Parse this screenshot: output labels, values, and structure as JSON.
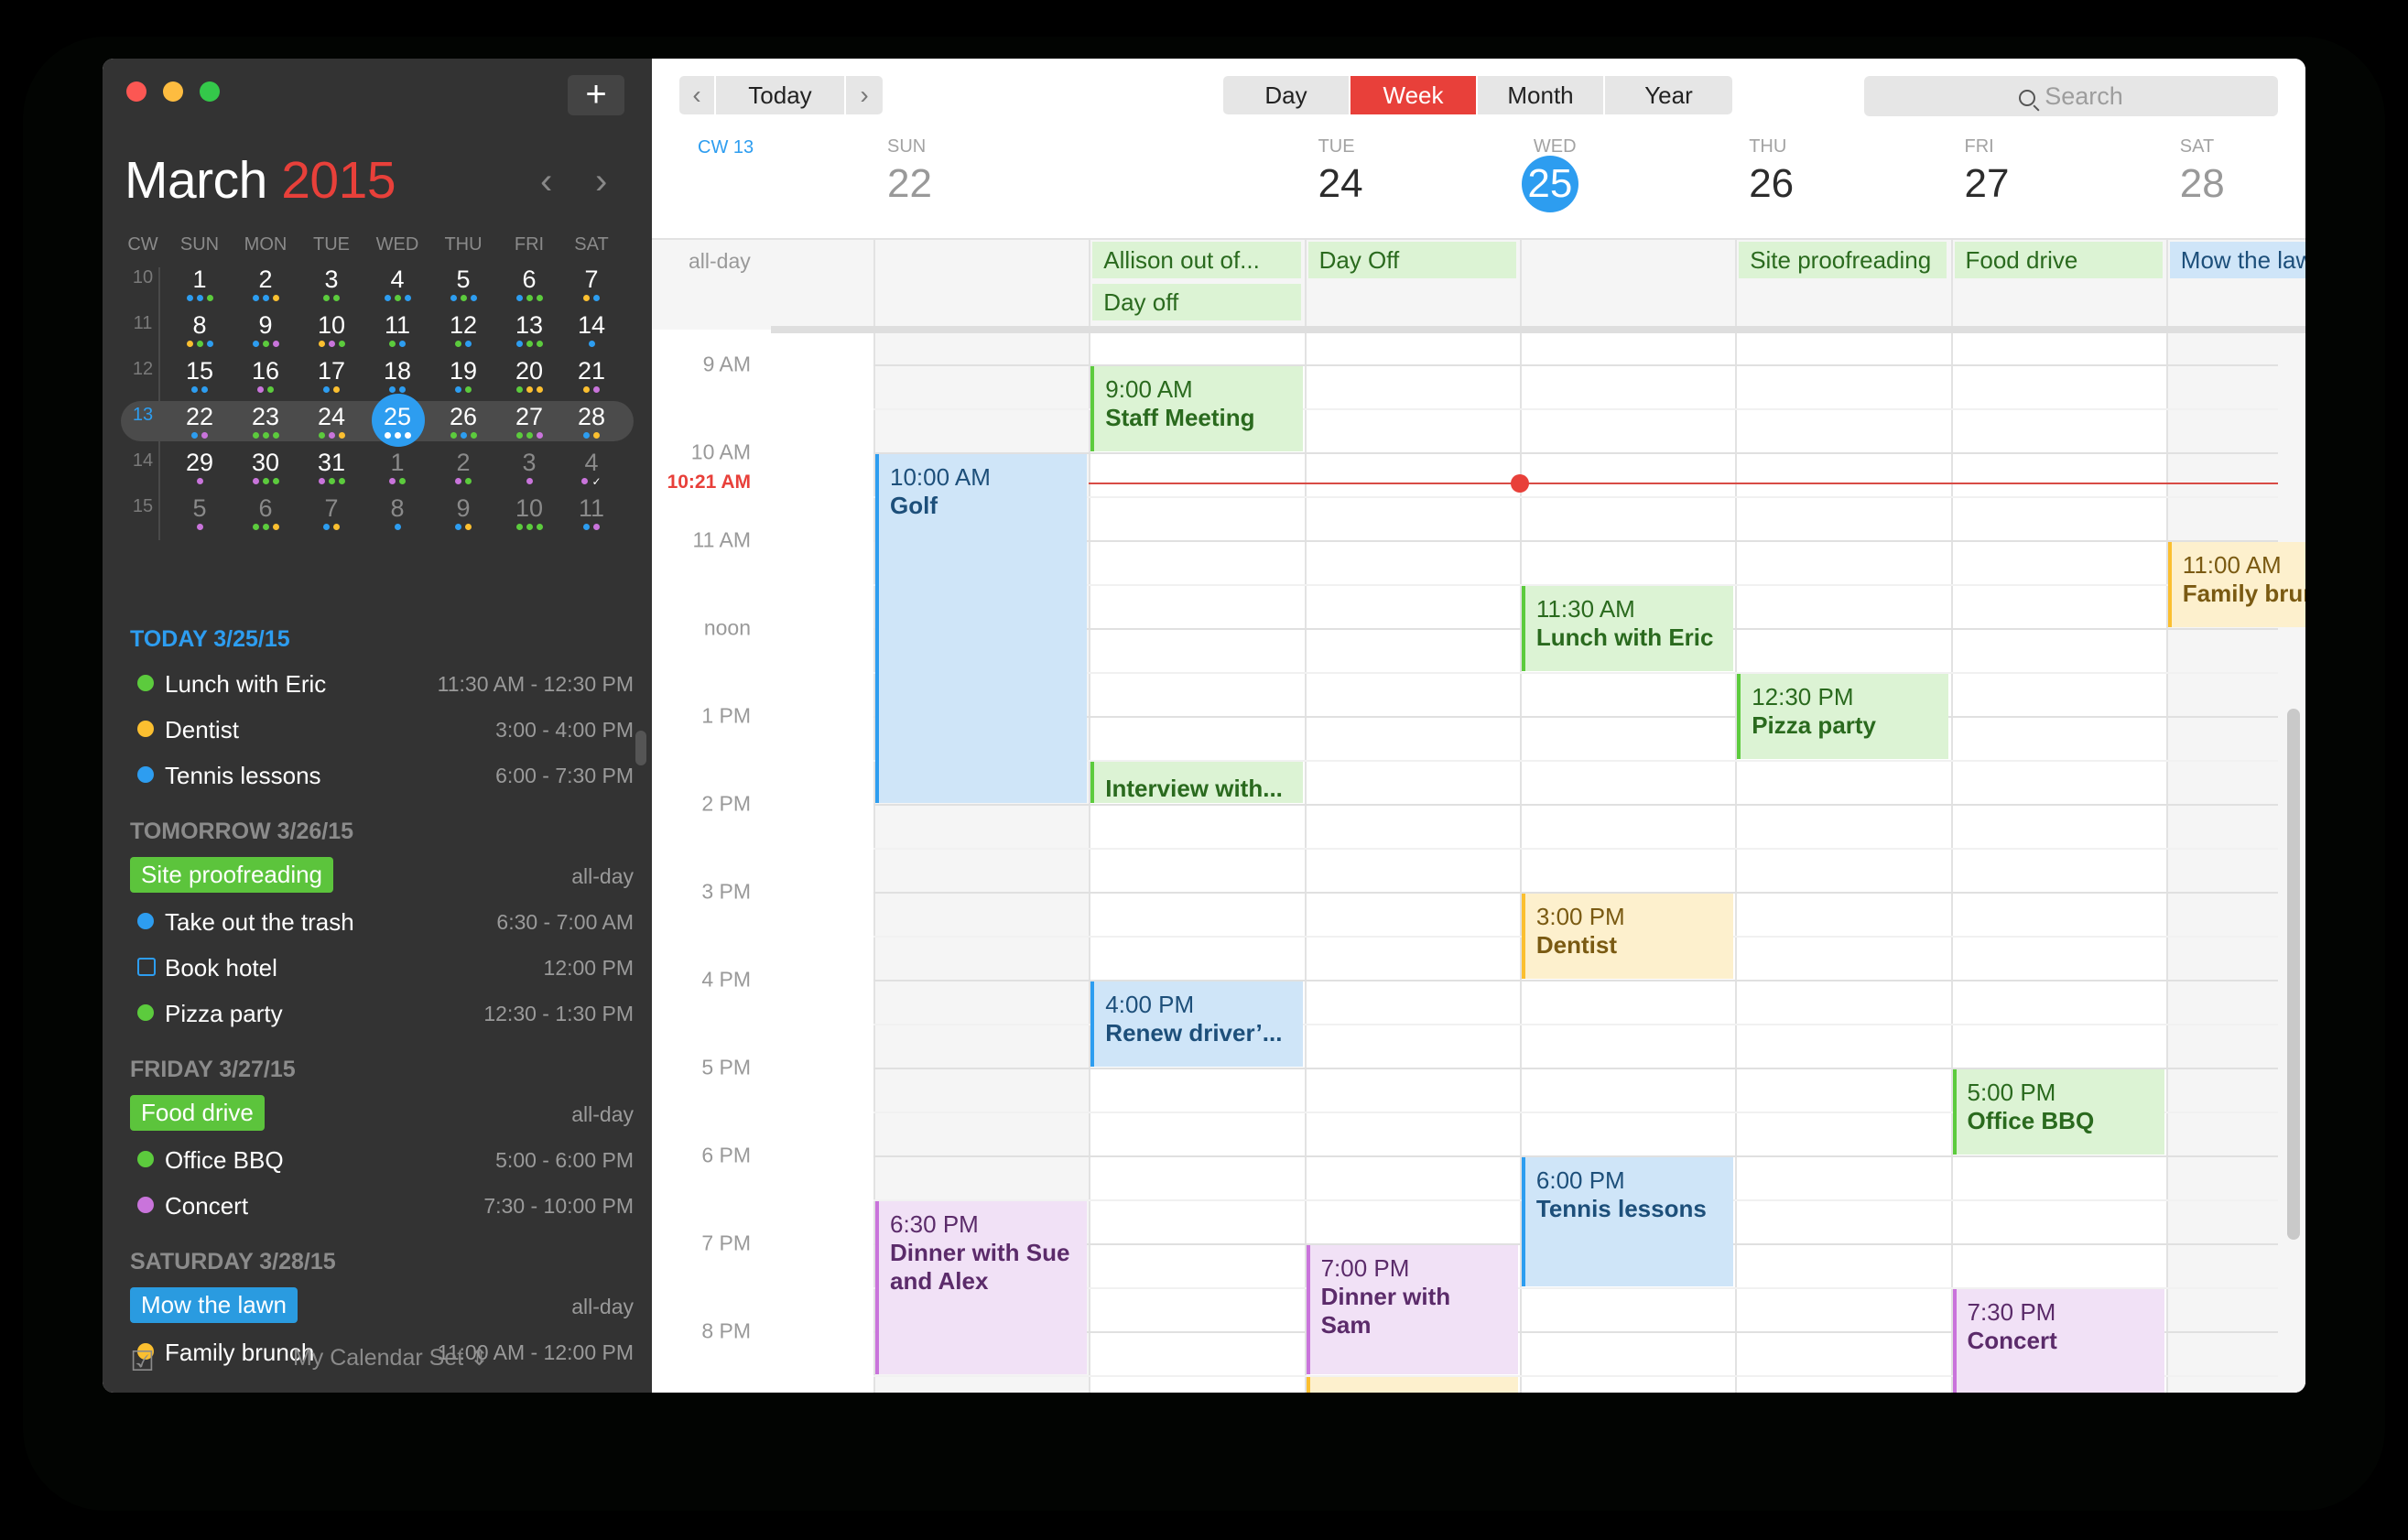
{
  "window": {
    "traffic_lights": [
      "close",
      "minimize",
      "zoom"
    ],
    "add_button": "+"
  },
  "sidebar": {
    "month_title": {
      "month": "March",
      "year": "2015"
    },
    "nav": {
      "prev": "‹",
      "next": "›"
    },
    "mini_calendar": {
      "headers": [
        "CW",
        "SUN",
        "MON",
        "TUE",
        "WED",
        "THU",
        "FRI",
        "SAT"
      ],
      "weeks": [
        {
          "cw": "10",
          "current": false,
          "days": [
            {
              "n": "1",
              "dots": [
                "blue",
                "blue",
                "green"
              ]
            },
            {
              "n": "2",
              "dots": [
                "blue",
                "blue",
                "yellow"
              ]
            },
            {
              "n": "3",
              "dots": [
                "green",
                "green"
              ]
            },
            {
              "n": "4",
              "dots": [
                "blue",
                "green",
                "blue"
              ]
            },
            {
              "n": "5",
              "dots": [
                "blue",
                "green",
                "blue"
              ]
            },
            {
              "n": "6",
              "dots": [
                "blue",
                "green",
                "green"
              ]
            },
            {
              "n": "7",
              "dots": [
                "yellow",
                "blue"
              ]
            }
          ]
        },
        {
          "cw": "11",
          "current": false,
          "days": [
            {
              "n": "8",
              "dots": [
                "yellow",
                "green",
                "blue"
              ]
            },
            {
              "n": "9",
              "dots": [
                "blue",
                "green",
                "purple"
              ]
            },
            {
              "n": "10",
              "dots": [
                "yellow",
                "purple",
                "green"
              ]
            },
            {
              "n": "11",
              "dots": [
                "green",
                "blue"
              ]
            },
            {
              "n": "12",
              "dots": [
                "green",
                "blue"
              ]
            },
            {
              "n": "13",
              "dots": [
                "blue",
                "green",
                "green"
              ]
            },
            {
              "n": "14",
              "dots": [
                "blue"
              ]
            }
          ]
        },
        {
          "cw": "12",
          "current": false,
          "days": [
            {
              "n": "15",
              "dots": [
                "blue",
                "blue"
              ]
            },
            {
              "n": "16",
              "dots": [
                "purple",
                "green"
              ]
            },
            {
              "n": "17",
              "dots": [
                "blue",
                "yellow"
              ]
            },
            {
              "n": "18",
              "dots": [
                "blue",
                "blue"
              ]
            },
            {
              "n": "19",
              "dots": [
                "blue",
                "green"
              ]
            },
            {
              "n": "20",
              "dots": [
                "green",
                "yellow",
                "yellow"
              ]
            },
            {
              "n": "21",
              "dots": [
                "yellow",
                "purple"
              ]
            }
          ]
        },
        {
          "cw": "13",
          "current": true,
          "days": [
            {
              "n": "22",
              "dots": [
                "blue",
                "purple"
              ]
            },
            {
              "n": "23",
              "dots": [
                "green",
                "green",
                "green"
              ]
            },
            {
              "n": "24",
              "dots": [
                "green",
                "purple",
                "yellow"
              ]
            },
            {
              "n": "25",
              "dots": [
                "blue",
                "blue",
                "blue"
              ],
              "today": true
            },
            {
              "n": "26",
              "dots": [
                "green",
                "blue",
                "green"
              ]
            },
            {
              "n": "27",
              "dots": [
                "green",
                "green",
                "purple"
              ]
            },
            {
              "n": "28",
              "dots": [
                "blue",
                "yellow"
              ]
            }
          ]
        },
        {
          "cw": "14",
          "current": false,
          "days": [
            {
              "n": "29",
              "dots": [
                "purple"
              ]
            },
            {
              "n": "30",
              "dots": [
                "purple",
                "green",
                "green"
              ]
            },
            {
              "n": "31",
              "dots": [
                "purple",
                "green",
                "green"
              ]
            },
            {
              "n": "1",
              "dots": [
                "purple",
                "green"
              ],
              "other": true
            },
            {
              "n": "2",
              "dots": [
                "purple",
                "green"
              ],
              "other": true
            },
            {
              "n": "3",
              "dots": [
                "purple"
              ],
              "other": true
            },
            {
              "n": "4",
              "dots": [
                "purple",
                "check"
              ],
              "other": true
            }
          ]
        },
        {
          "cw": "15",
          "current": false,
          "days": [
            {
              "n": "5",
              "dots": [
                "purple"
              ],
              "other": true
            },
            {
              "n": "6",
              "dots": [
                "green",
                "green",
                "yellow"
              ],
              "other": true
            },
            {
              "n": "7",
              "dots": [
                "blue",
                "yellow"
              ],
              "other": true
            },
            {
              "n": "8",
              "dots": [
                "blue"
              ],
              "other": true
            },
            {
              "n": "9",
              "dots": [
                "blue",
                "yellow"
              ],
              "other": true
            },
            {
              "n": "10",
              "dots": [
                "green",
                "green",
                "green"
              ],
              "other": true
            },
            {
              "n": "11",
              "dots": [
                "blue",
                "purple"
              ],
              "other": true
            }
          ]
        }
      ]
    },
    "agenda": [
      {
        "heading": "TODAY 3/25/15",
        "is_today": true,
        "items": [
          {
            "kind": "dot",
            "color": "green",
            "title": "Lunch with Eric",
            "time": "11:30 AM - 12:30 PM"
          },
          {
            "kind": "dot",
            "color": "yellow",
            "title": "Dentist",
            "time": "3:00 - 4:00 PM"
          },
          {
            "kind": "dot",
            "color": "blue",
            "title": "Tennis lessons",
            "time": "6:00 - 7:30 PM"
          }
        ]
      },
      {
        "heading": "TOMORROW 3/26/15",
        "is_today": false,
        "items": [
          {
            "kind": "pill",
            "color": "green",
            "title": "Site proofreading",
            "time": "all-day"
          },
          {
            "kind": "dot",
            "color": "blue",
            "title": "Take out the trash",
            "time": "6:30 - 7:00 AM"
          },
          {
            "kind": "task",
            "color": "blue",
            "title": "Book hotel",
            "time": "12:00 PM"
          },
          {
            "kind": "dot",
            "color": "green",
            "title": "Pizza party",
            "time": "12:30 - 1:30 PM"
          }
        ]
      },
      {
        "heading": "FRIDAY 3/27/15",
        "is_today": false,
        "items": [
          {
            "kind": "pill",
            "color": "green",
            "title": "Food drive",
            "time": "all-day"
          },
          {
            "kind": "dot",
            "color": "green",
            "title": "Office BBQ",
            "time": "5:00 - 6:00 PM"
          },
          {
            "kind": "dot",
            "color": "purple",
            "title": "Concert",
            "time": "7:30 - 10:00 PM"
          }
        ]
      },
      {
        "heading": "SATURDAY 3/28/15",
        "is_today": false,
        "items": [
          {
            "kind": "pill",
            "color": "blue",
            "title": "Mow the lawn",
            "time": "all-day"
          },
          {
            "kind": "dot",
            "color": "yellow",
            "title": "Family brunch",
            "time": "11:00 AM - 12:00 PM"
          }
        ]
      }
    ],
    "footer": {
      "calendar_set": "My Calendar Set ⇕",
      "tasks_icon": "checkbox-icon"
    }
  },
  "toolbar": {
    "prev": "‹",
    "today": "Today",
    "next": "›",
    "views": [
      "Day",
      "Week",
      "Month",
      "Year"
    ],
    "active_view": "Week",
    "search_placeholder": "Search"
  },
  "week": {
    "cw_label": "CW 13",
    "days": [
      {
        "name": "SUN",
        "date": "22",
        "weekend": true
      },
      {
        "name": "",
        "date": "",
        "weekend": false
      },
      {
        "name": "TUE",
        "date": "24",
        "weekend": false
      },
      {
        "name": "WED",
        "date": "25",
        "weekend": false,
        "today": true
      },
      {
        "name": "THU",
        "date": "26",
        "weekend": false
      },
      {
        "name": "FRI",
        "date": "27",
        "weekend": false
      },
      {
        "name": "SAT",
        "date": "28",
        "weekend": true
      }
    ],
    "allday_label": "all-day",
    "allday_events": [
      {
        "day": 1,
        "row": 0,
        "title": "Allison out of...",
        "color": "green"
      },
      {
        "day": 1,
        "row": 1,
        "title": "Day off",
        "color": "green"
      },
      {
        "day": 2,
        "row": 0,
        "title": "Day Off",
        "color": "green"
      },
      {
        "day": 4,
        "row": 0,
        "title": "Site proofreading",
        "color": "green"
      },
      {
        "day": 5,
        "row": 0,
        "title": "Food drive",
        "color": "green"
      },
      {
        "day": 6,
        "row": 0,
        "title": "Mow the lawn",
        "color": "blue"
      }
    ],
    "hour_labels": [
      {
        "h": 9,
        "label": "9 AM"
      },
      {
        "h": 10,
        "label": "10 AM"
      },
      {
        "h": 11,
        "label": "11 AM"
      },
      {
        "h": 12,
        "label": "noon"
      },
      {
        "h": 13,
        "label": "1 PM"
      },
      {
        "h": 14,
        "label": "2 PM"
      },
      {
        "h": 15,
        "label": "3 PM"
      },
      {
        "h": 16,
        "label": "4 PM"
      },
      {
        "h": 17,
        "label": "5 PM"
      },
      {
        "h": 18,
        "label": "6 PM"
      },
      {
        "h": 19,
        "label": "7 PM"
      },
      {
        "h": 20,
        "label": "8 PM"
      }
    ],
    "now": {
      "label": "10:21 AM",
      "hour": 10.35,
      "day": 3
    },
    "events": [
      {
        "day": 4,
        "start": 8.0,
        "end": 8.1,
        "time": "",
        "title": "",
        "color": "blue"
      },
      {
        "day": 1,
        "start": 9.0,
        "end": 10.0,
        "time": "9:00 AM",
        "title": "Staff Meeting",
        "color": "green"
      },
      {
        "day": 0,
        "start": 10.0,
        "end": 14.0,
        "time": "10:00 AM",
        "title": "Golf",
        "color": "blue"
      },
      {
        "day": 6,
        "start": 11.0,
        "end": 12.0,
        "time": "11:00 AM",
        "title": "Family brunch",
        "color": "yellow"
      },
      {
        "day": 3,
        "start": 11.5,
        "end": 12.5,
        "time": "11:30 AM",
        "title": "Lunch with Eric",
        "color": "green"
      },
      {
        "day": 4,
        "start": 12.5,
        "end": 13.5,
        "time": "12:30 PM",
        "title": "Pizza party",
        "color": "green"
      },
      {
        "day": 1,
        "start": 13.5,
        "end": 14.0,
        "time": "",
        "title": "Interview with...",
        "color": "green"
      },
      {
        "day": 3,
        "start": 15.0,
        "end": 16.0,
        "time": "3:00 PM",
        "title": "Dentist",
        "color": "yellow"
      },
      {
        "day": 1,
        "start": 16.0,
        "end": 17.0,
        "time": "4:00 PM",
        "title": "Renew driver’...",
        "color": "blue"
      },
      {
        "day": 5,
        "start": 17.0,
        "end": 18.0,
        "time": "5:00 PM",
        "title": "Office BBQ",
        "color": "green"
      },
      {
        "day": 3,
        "start": 18.0,
        "end": 19.5,
        "time": "6:00 PM",
        "title": "Tennis lessons",
        "color": "blue"
      },
      {
        "day": 0,
        "start": 18.5,
        "end": 20.5,
        "time": "6:30 PM",
        "title": "Dinner with Sue and Alex",
        "color": "purple"
      },
      {
        "day": 2,
        "start": 19.0,
        "end": 20.5,
        "time": "7:00 PM",
        "title": "Dinner with Sam",
        "color": "purple"
      },
      {
        "day": 2,
        "start": 20.5,
        "end": 21.5,
        "time": "",
        "title": "",
        "color": "yellow"
      },
      {
        "day": 5,
        "start": 19.5,
        "end": 22.0,
        "time": "7:30 PM",
        "title": "Concert",
        "color": "purple"
      }
    ]
  },
  "colors": {
    "blue": "#2d9df0",
    "green": "#5ccb3d",
    "yellow": "#fbbf30",
    "purple": "#c974db",
    "accent_red": "#e8403a",
    "sidebar_bg": "#333333"
  }
}
